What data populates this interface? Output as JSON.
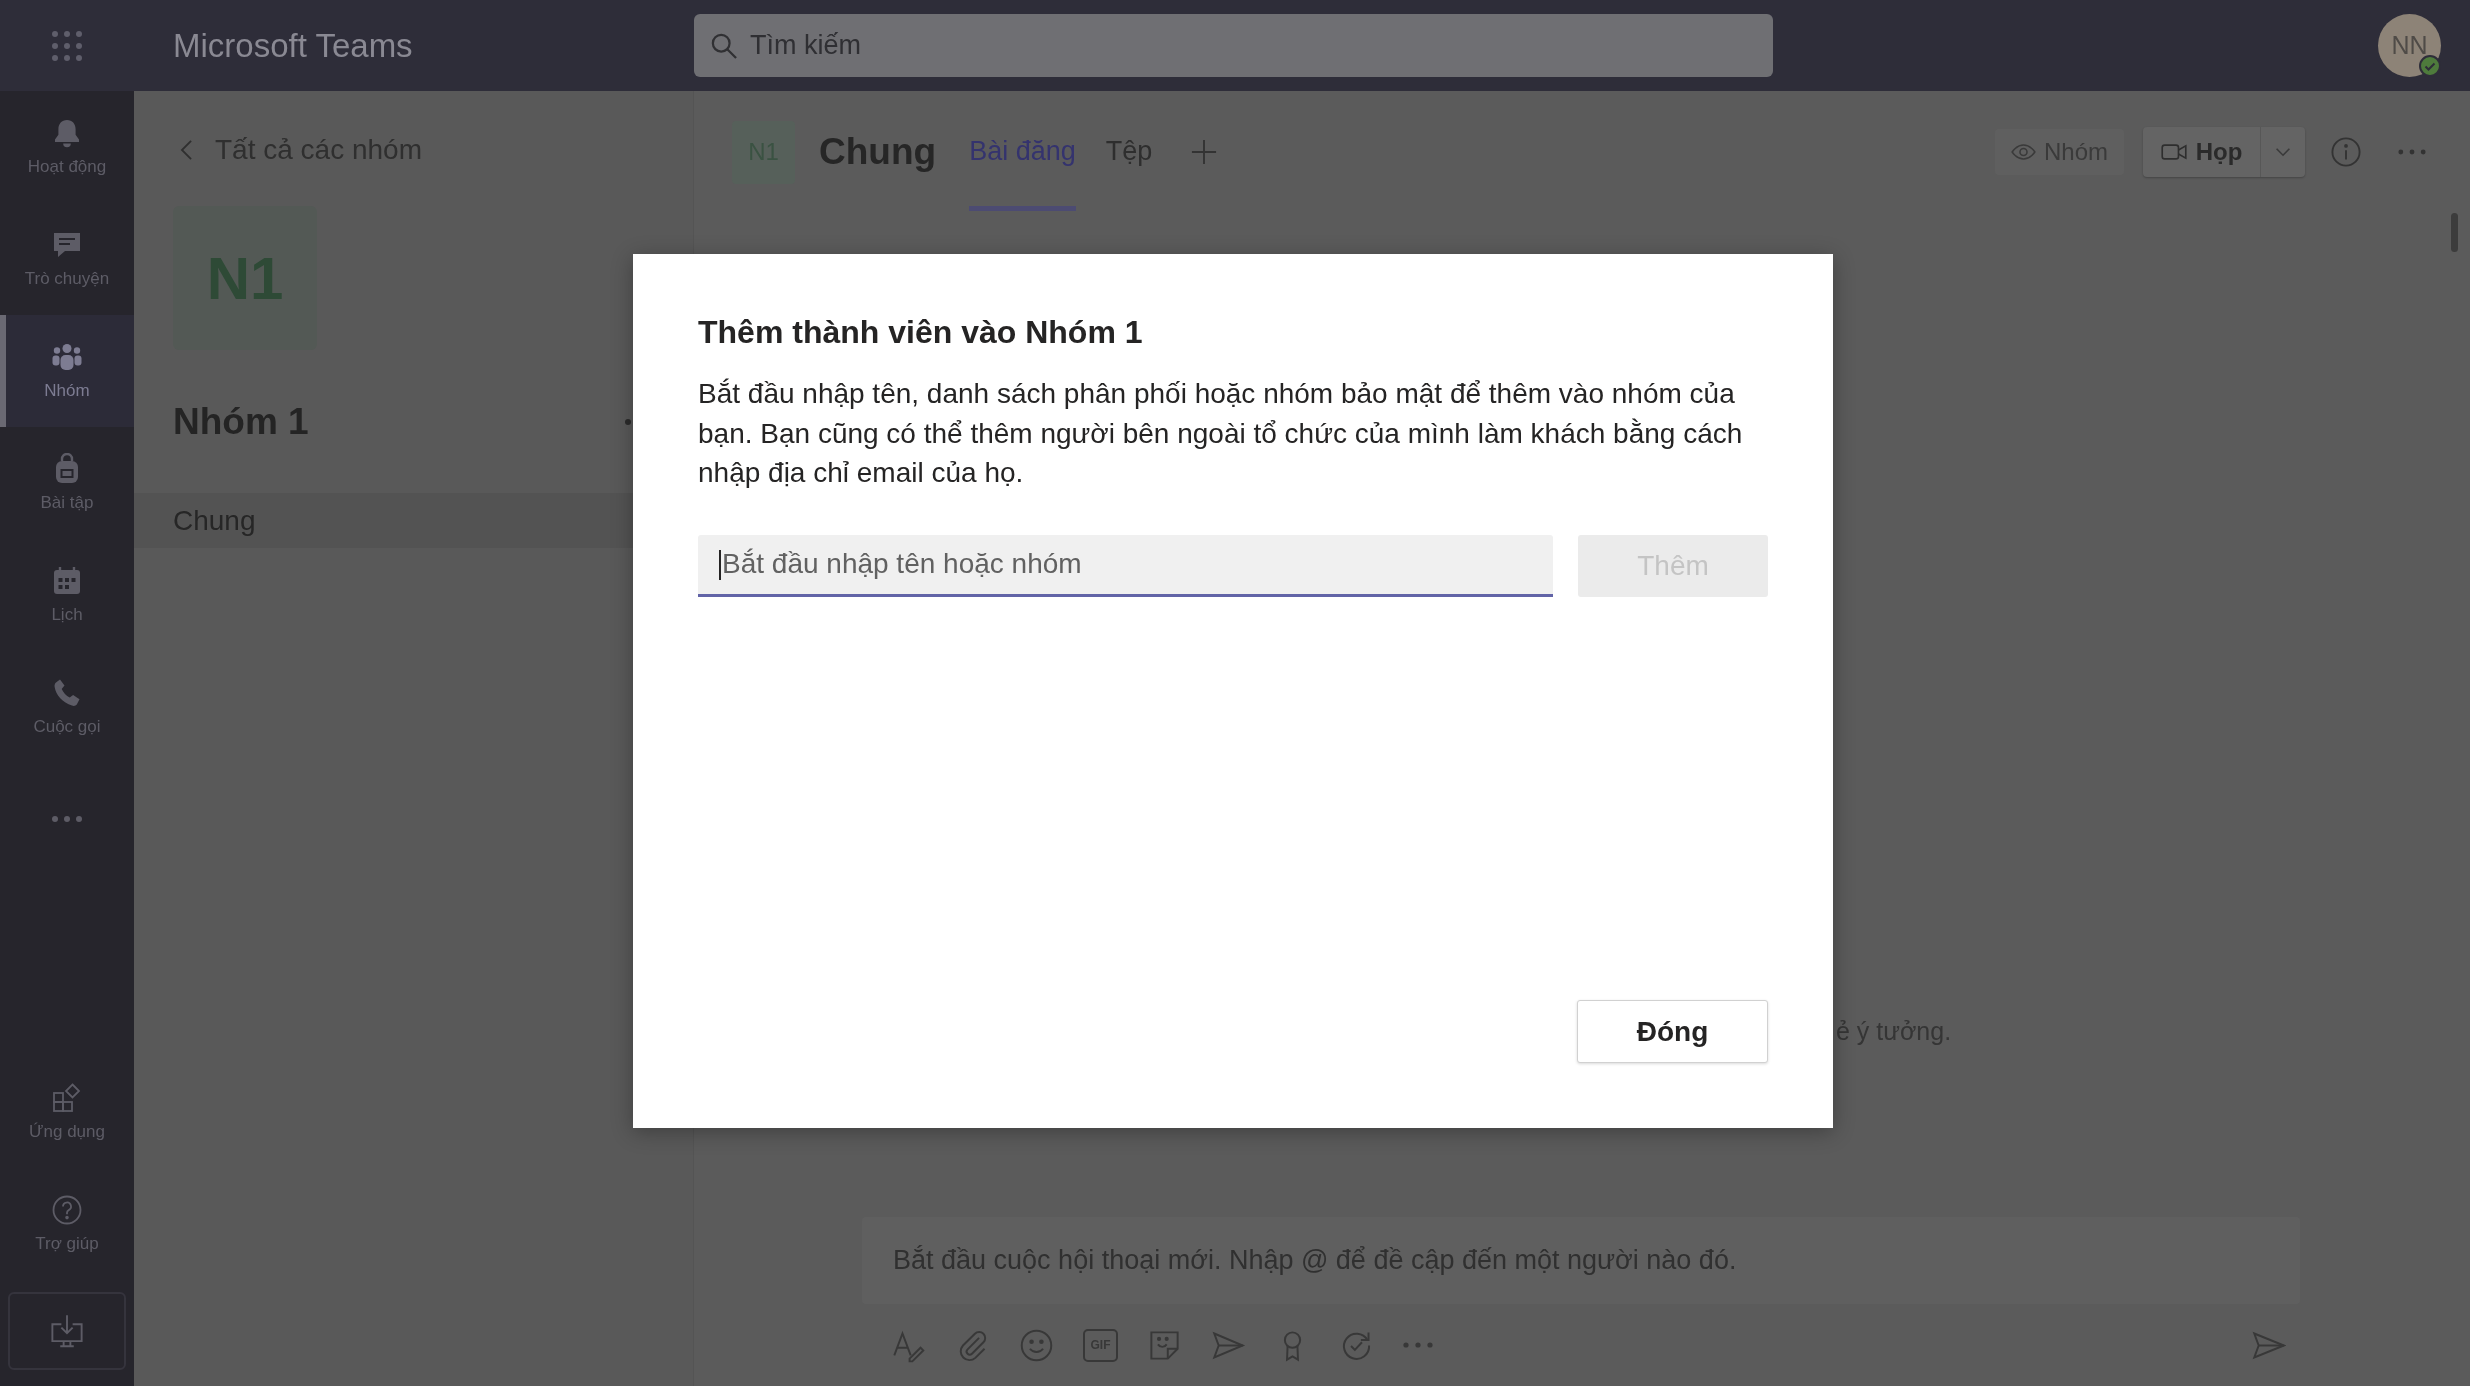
{
  "top_bar": {
    "app_name": "Microsoft Teams",
    "search": {
      "placeholder": "Tìm kiếm"
    },
    "avatar": {
      "initials": "NN",
      "available": true
    }
  },
  "rail": {
    "items": [
      {
        "label": "Hoạt động",
        "selected": false
      },
      {
        "label": "Trò chuyện",
        "selected": false
      },
      {
        "label": "Nhóm",
        "selected": true
      },
      {
        "label": "Bài tập",
        "selected": false
      },
      {
        "label": "Lịch",
        "selected": false
      },
      {
        "label": "Cuộc gọi",
        "selected": false
      }
    ],
    "bottom_items": [
      {
        "label": "Ứng dụng",
        "selected": false
      },
      {
        "label": "Trợ giúp",
        "selected": false
      }
    ]
  },
  "team_panel": {
    "back_link": "Tất cả các nhóm",
    "team": {
      "initials": "N1",
      "name": "Nhóm 1"
    },
    "channels": [
      {
        "name": "Chung",
        "selected": true
      }
    ]
  },
  "channel_view": {
    "header": {
      "team_initials": "N1",
      "channel": "Chung",
      "tabs": [
        {
          "label": "Bài đăng",
          "selected": true
        },
        {
          "label": "Tệp",
          "selected": false
        }
      ],
      "view_button": "Nhóm",
      "meet_button": "Họp"
    },
    "content_text": "ẻ ý tưởng.",
    "compose": {
      "placeholder": "Bắt đầu cuộc hội thoại mới. Nhập @ để đề cập đến một người nào đó.",
      "gif_label": "GIF"
    }
  },
  "dialog": {
    "title": "Thêm thành viên vào Nhóm 1",
    "description": "Bắt đầu nhập tên, danh sách phân phối hoặc nhóm bảo mật để thêm vào nhóm của bạn. Bạn cũng có thể thêm người bên ngoài tổ chức của mình làm khách bằng cách nhập địa chỉ email của họ.",
    "input": {
      "placeholder": "Bắt đầu nhập tên hoặc nhóm",
      "focused": true
    },
    "add_button": {
      "label": "Thêm",
      "disabled": true
    },
    "close_button": "Đóng"
  }
}
